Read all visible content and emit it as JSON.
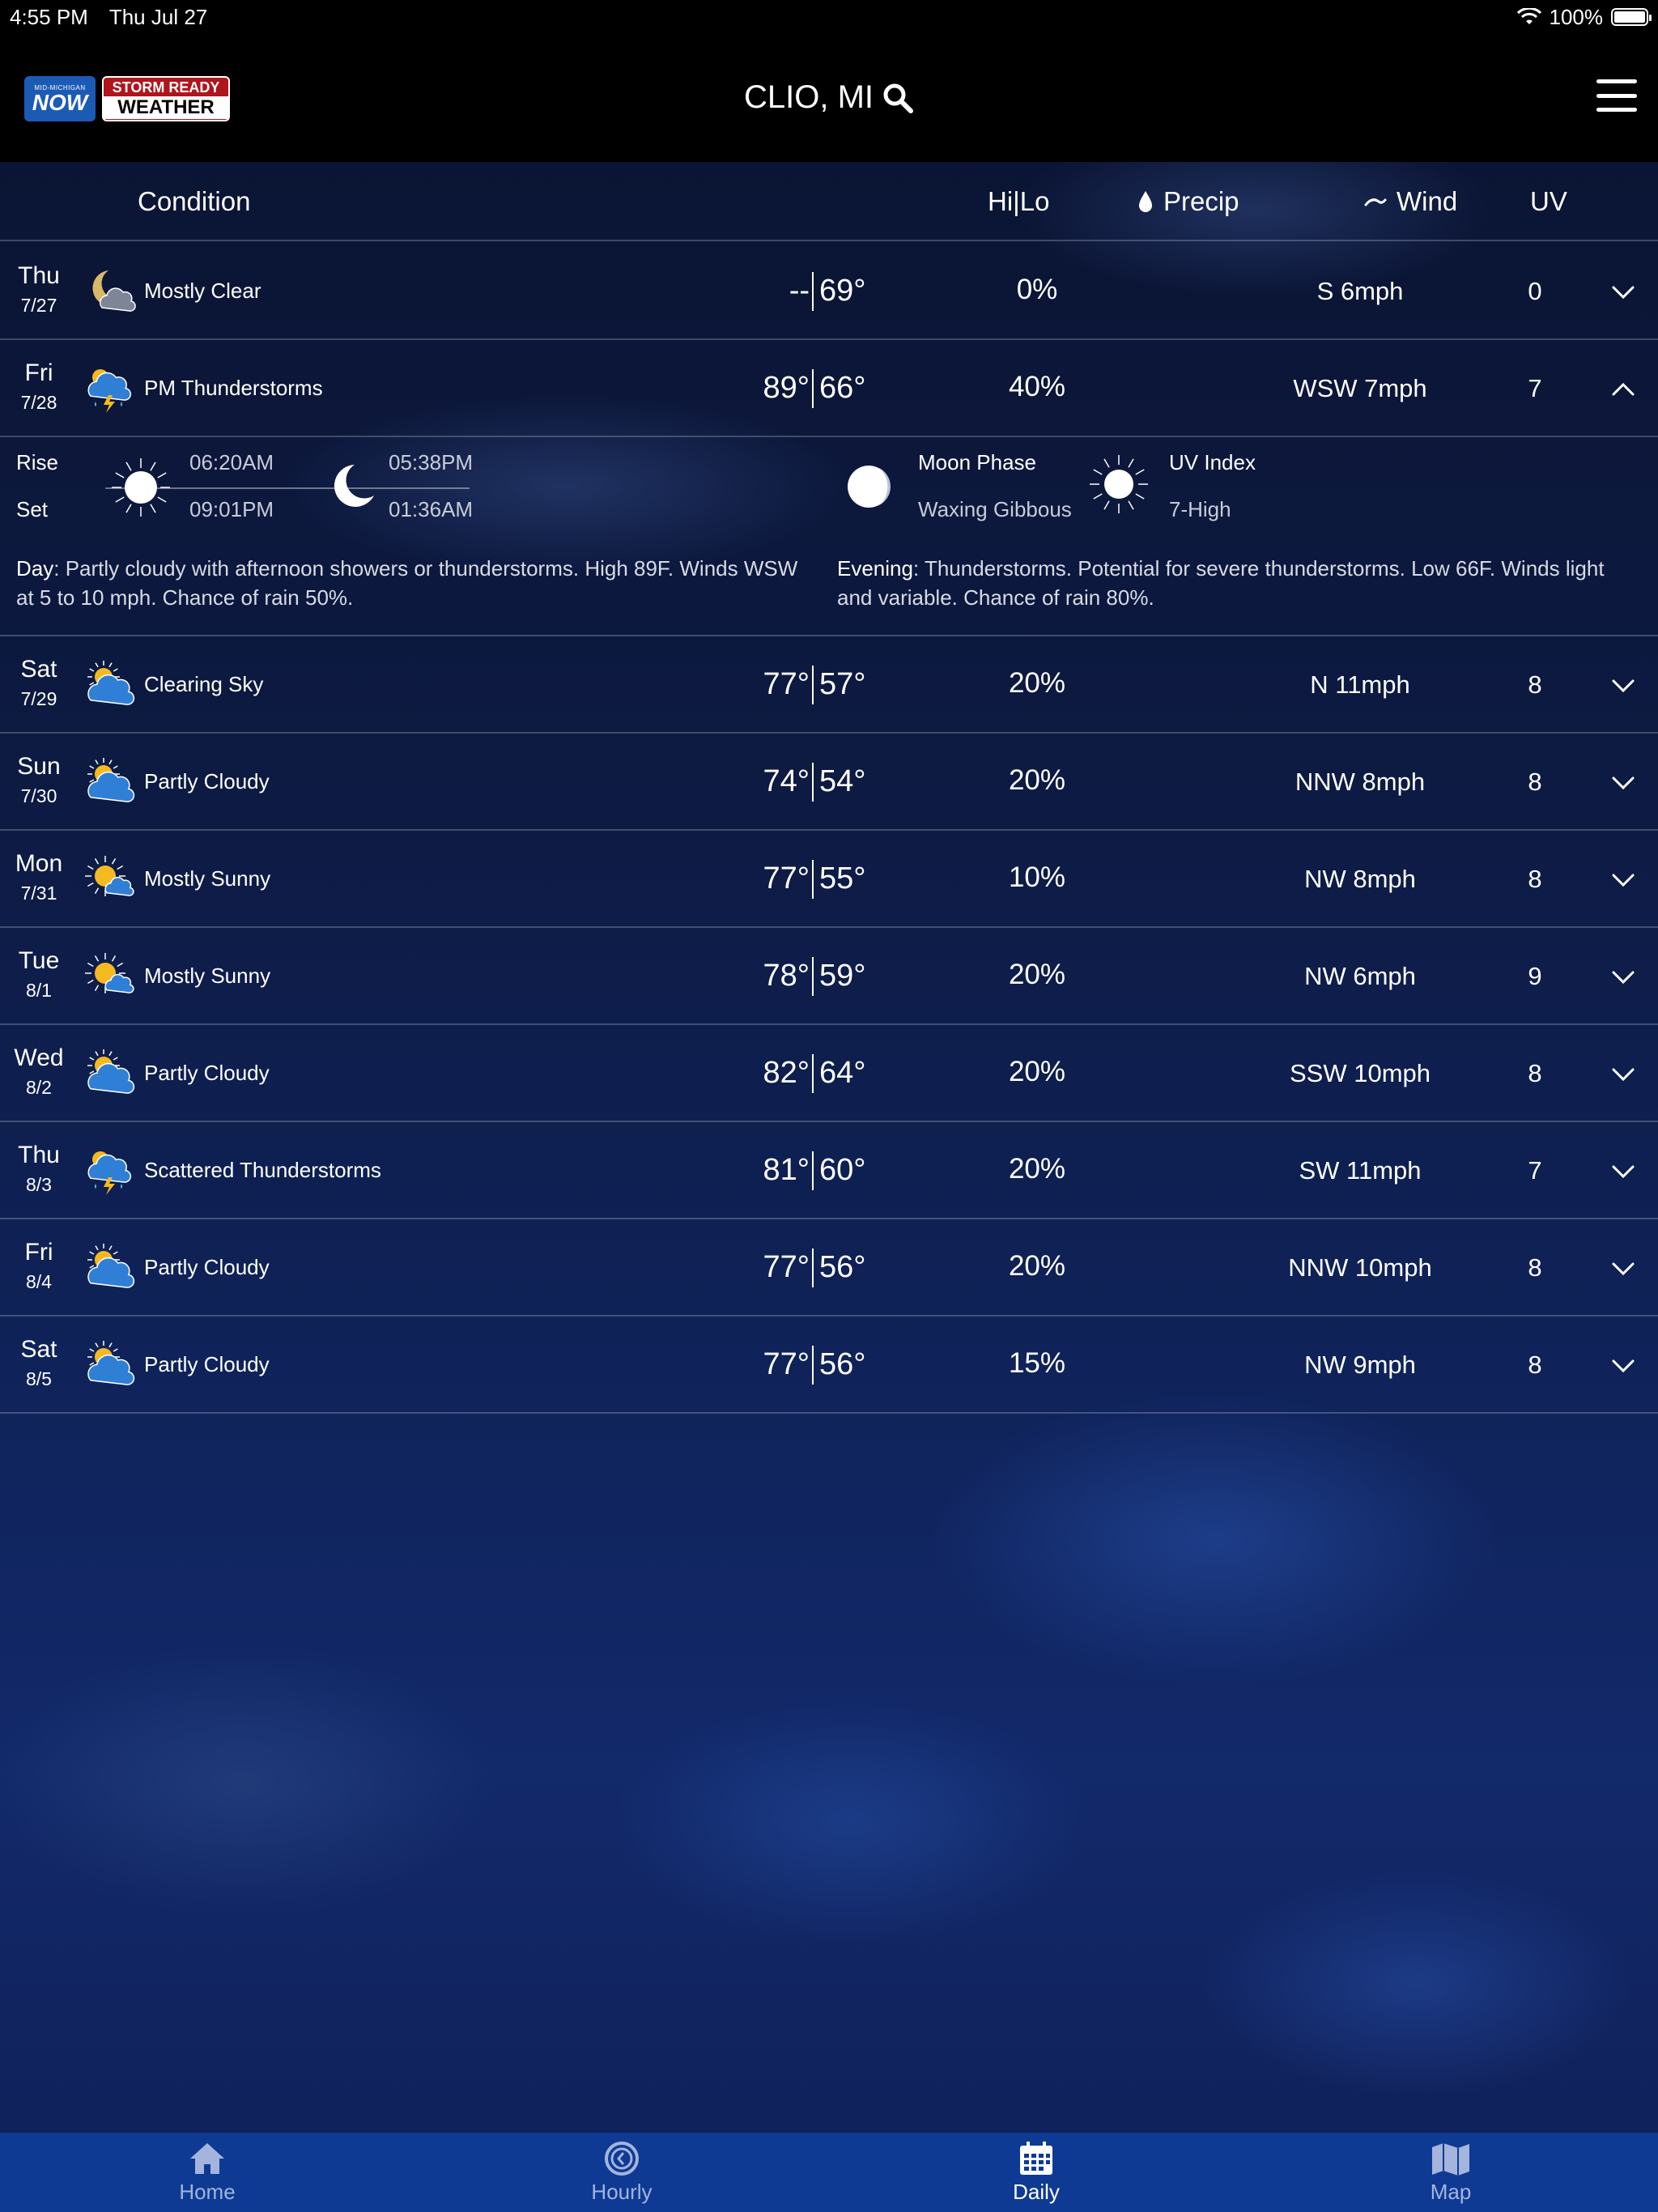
{
  "status_bar": {
    "time": "4:55 PM",
    "date": "Thu Jul 27",
    "battery": "100%",
    "battery_level": 1.0
  },
  "header": {
    "logo_now_small": "MID-MICHIGAN",
    "logo_now": "NOW",
    "logo_storm_top": "STORM READY",
    "logo_storm_bottom": "WEATHER",
    "location": "CLIO, MI"
  },
  "columns": {
    "condition": "Condition",
    "hilo": "Hi|Lo",
    "precip": "Precip",
    "wind": "Wind",
    "uv": "UV"
  },
  "days": [
    {
      "day": "Thu",
      "date": "7/27",
      "icon": "moon-cloud-icon",
      "condition": "Mostly Clear",
      "hi": "--",
      "lo": "69°",
      "precip": "0%",
      "wind": "S 6mph",
      "uv": "0",
      "expanded": false
    },
    {
      "day": "Fri",
      "date": "7/28",
      "icon": "thunderstorm-icon",
      "condition": "PM Thunderstorms",
      "hi": "89°",
      "lo": "66°",
      "precip": "40%",
      "wind": "WSW 7mph",
      "uv": "7",
      "expanded": true
    },
    {
      "day": "Sat",
      "date": "7/29",
      "icon": "sun-cloud-icon",
      "condition": "Clearing Sky",
      "hi": "77°",
      "lo": "57°",
      "precip": "20%",
      "wind": "N 11mph",
      "uv": "8",
      "expanded": false
    },
    {
      "day": "Sun",
      "date": "7/30",
      "icon": "partly-cloudy-icon",
      "condition": "Partly Cloudy",
      "hi": "74°",
      "lo": "54°",
      "precip": "20%",
      "wind": "NNW 8mph",
      "uv": "8",
      "expanded": false
    },
    {
      "day": "Mon",
      "date": "7/31",
      "icon": "mostly-sunny-icon",
      "condition": "Mostly Sunny",
      "hi": "77°",
      "lo": "55°",
      "precip": "10%",
      "wind": "NW 8mph",
      "uv": "8",
      "expanded": false
    },
    {
      "day": "Tue",
      "date": "8/1",
      "icon": "mostly-sunny-icon",
      "condition": "Mostly Sunny",
      "hi": "78°",
      "lo": "59°",
      "precip": "20%",
      "wind": "NW 6mph",
      "uv": "9",
      "expanded": false
    },
    {
      "day": "Wed",
      "date": "8/2",
      "icon": "partly-cloudy-icon",
      "condition": "Partly Cloudy",
      "hi": "82°",
      "lo": "64°",
      "precip": "20%",
      "wind": "SSW 10mph",
      "uv": "8",
      "expanded": false
    },
    {
      "day": "Thu",
      "date": "8/3",
      "icon": "thunderstorm-icon",
      "condition": "Scattered Thunderstorms",
      "hi": "81°",
      "lo": "60°",
      "precip": "20%",
      "wind": "SW 11mph",
      "uv": "7",
      "expanded": false
    },
    {
      "day": "Fri",
      "date": "8/4",
      "icon": "partly-cloudy-icon",
      "condition": "Partly Cloudy",
      "hi": "77°",
      "lo": "56°",
      "precip": "20%",
      "wind": "NNW 10mph",
      "uv": "8",
      "expanded": false
    },
    {
      "day": "Sat",
      "date": "8/5",
      "icon": "partly-cloudy-icon",
      "condition": "Partly Cloudy",
      "hi": "77°",
      "lo": "56°",
      "precip": "15%",
      "wind": "NW 9mph",
      "uv": "8",
      "expanded": false
    }
  ],
  "detail": {
    "rise_label": "Rise",
    "set_label": "Set",
    "sunrise": "06:20AM",
    "sunset": "09:01PM",
    "moonrise": "05:38PM",
    "moonset": "01:36AM",
    "moon_phase_label": "Moon Phase",
    "moon_phase": "Waxing Gibbous",
    "uv_index_label": "UV Index",
    "uv_index": "7-High",
    "day_label": "Day",
    "day_text": ": Partly cloudy with afternoon showers or thunderstorms. High 89F. Winds WSW at 5 to 10 mph. Chance of rain 50%.",
    "evening_label": "Evening",
    "evening_text": ": Thunderstorms. Potential for severe thunderstorms. Low 66F. Winds light and variable. Chance of rain 80%."
  },
  "tabs": [
    {
      "label": "Home",
      "icon": "home-icon",
      "active": false
    },
    {
      "label": "Hourly",
      "icon": "clock-icon",
      "active": false
    },
    {
      "label": "Daily",
      "icon": "calendar-icon",
      "active": true
    },
    {
      "label": "Map",
      "icon": "map-icon",
      "active": false
    }
  ],
  "colors": {
    "tabbar": "#0f3a93",
    "sun": "#f5b921",
    "cloud": "#2f7fd6"
  }
}
